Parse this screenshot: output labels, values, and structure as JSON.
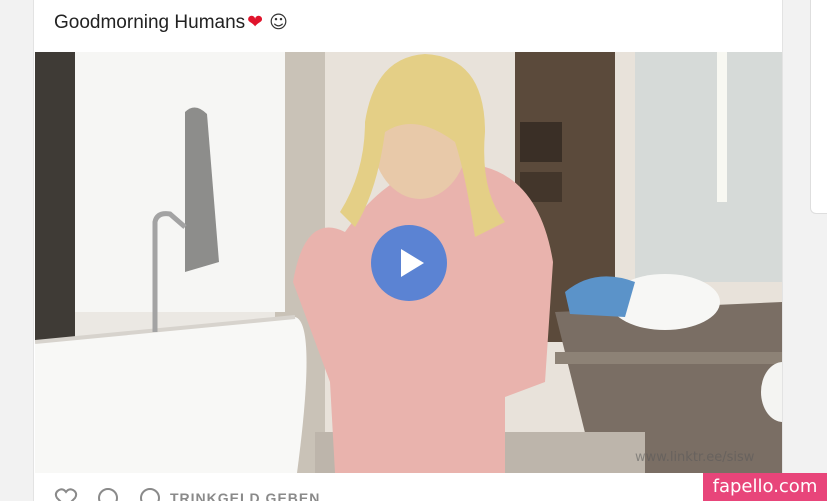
{
  "post": {
    "caption": "Goodmorning Humans",
    "caption_emoji_heart": "❤",
    "caption_emoji_smile": "☺"
  },
  "video": {
    "overlay_text": "www.linktr.ee/sisw",
    "play_icon": "play-icon"
  },
  "actions": {
    "like_icon": "heart-outline-icon",
    "comment_icon": "comment-bubble-icon",
    "tip_icon": "dollar-circle-icon",
    "tip_label": "TRINKGELD GEBEN"
  },
  "badge": {
    "text": "fapello.com"
  },
  "colors": {
    "accent": "#e8457a",
    "play": "#4b7dd7",
    "heart": "#e0142c"
  }
}
